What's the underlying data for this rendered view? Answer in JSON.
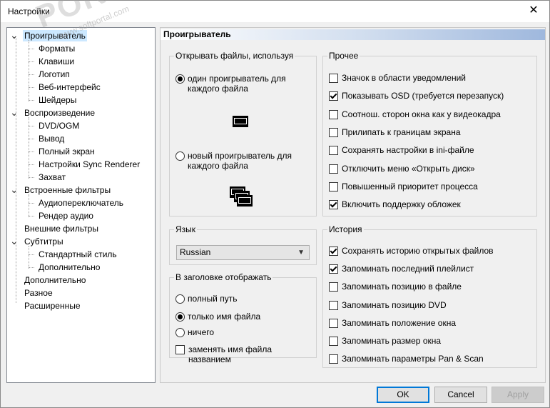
{
  "window": {
    "title": "Настройки",
    "close_glyph": "✕"
  },
  "tree": {
    "items": [
      {
        "label": "Проигрыватель",
        "level": 0,
        "expanded": true,
        "selected": true
      },
      {
        "label": "Форматы",
        "level": 1
      },
      {
        "label": "Клавиши",
        "level": 1
      },
      {
        "label": "Логотип",
        "level": 1
      },
      {
        "label": "Веб-интерфейс",
        "level": 1
      },
      {
        "label": "Шейдеры",
        "level": 1
      },
      {
        "label": "Воспроизведение",
        "level": 0,
        "expanded": true
      },
      {
        "label": "DVD/OGM",
        "level": 1
      },
      {
        "label": "Вывод",
        "level": 1
      },
      {
        "label": "Полный экран",
        "level": 1
      },
      {
        "label": "Настройки Sync Renderer",
        "level": 1
      },
      {
        "label": "Захват",
        "level": 1
      },
      {
        "label": "Встроенные фильтры",
        "level": 0,
        "expanded": true
      },
      {
        "label": "Аудиопереключатель",
        "level": 1
      },
      {
        "label": "Рендер аудио",
        "level": 1
      },
      {
        "label": "Внешние фильтры",
        "level": 0
      },
      {
        "label": "Субтитры",
        "level": 0,
        "expanded": true
      },
      {
        "label": "Стандартный стиль",
        "level": 1
      },
      {
        "label": "Дополнительно",
        "level": 1
      },
      {
        "label": "Дополнительно",
        "level": 0
      },
      {
        "label": "Разное",
        "level": 0
      },
      {
        "label": "Расширенные",
        "level": 0
      }
    ]
  },
  "page": {
    "header": "Проигрыватель",
    "open_files": {
      "legend": "Открывать файлы, используя",
      "option_single": "один проигрыватель для каждого файла",
      "option_new": "новый проигрыватель для каждого файла",
      "selected": "single"
    },
    "language": {
      "legend": "Язык",
      "value": "Russian"
    },
    "title_display": {
      "legend": "В заголовке отображать",
      "options": [
        "полный путь",
        "только имя файла",
        "ничего"
      ],
      "selected_index": 1,
      "replace_label": "заменять имя файла названием",
      "replace_checked": false
    },
    "other": {
      "legend": "Прочее",
      "items": [
        {
          "label": "Значок в области уведомлений",
          "checked": false
        },
        {
          "label": "Показывать OSD (требуется перезапуск)",
          "checked": true
        },
        {
          "label": "Соотнош. сторон окна как у видеокадра",
          "checked": false
        },
        {
          "label": "Прилипать к границам экрана",
          "checked": false
        },
        {
          "label": "Сохранять настройки в ini-файле",
          "checked": false
        },
        {
          "label": "Отключить меню «Открыть диск»",
          "checked": false
        },
        {
          "label": "Повышенный приоритет процесса",
          "checked": false
        },
        {
          "label": "Включить поддержку обложек",
          "checked": true
        }
      ]
    },
    "history": {
      "legend": "История",
      "items": [
        {
          "label": "Сохранять историю открытых файлов",
          "checked": true
        },
        {
          "label": "Запоминать последний плейлист",
          "checked": true
        },
        {
          "label": "Запоминать позицию в файле",
          "checked": false
        },
        {
          "label": "Запоминать позицию DVD",
          "checked": false
        },
        {
          "label": "Запоминать положение окна",
          "checked": false
        },
        {
          "label": "Запоминать размер окна",
          "checked": false
        },
        {
          "label": "Запоминать параметры Pan & Scan",
          "checked": false
        }
      ]
    }
  },
  "buttons": {
    "ok": "OK",
    "cancel": "Cancel",
    "apply": "Apply"
  },
  "watermark": {
    "big": "PORTAL",
    "small": "www.softportal.com",
    "tm": "™"
  }
}
